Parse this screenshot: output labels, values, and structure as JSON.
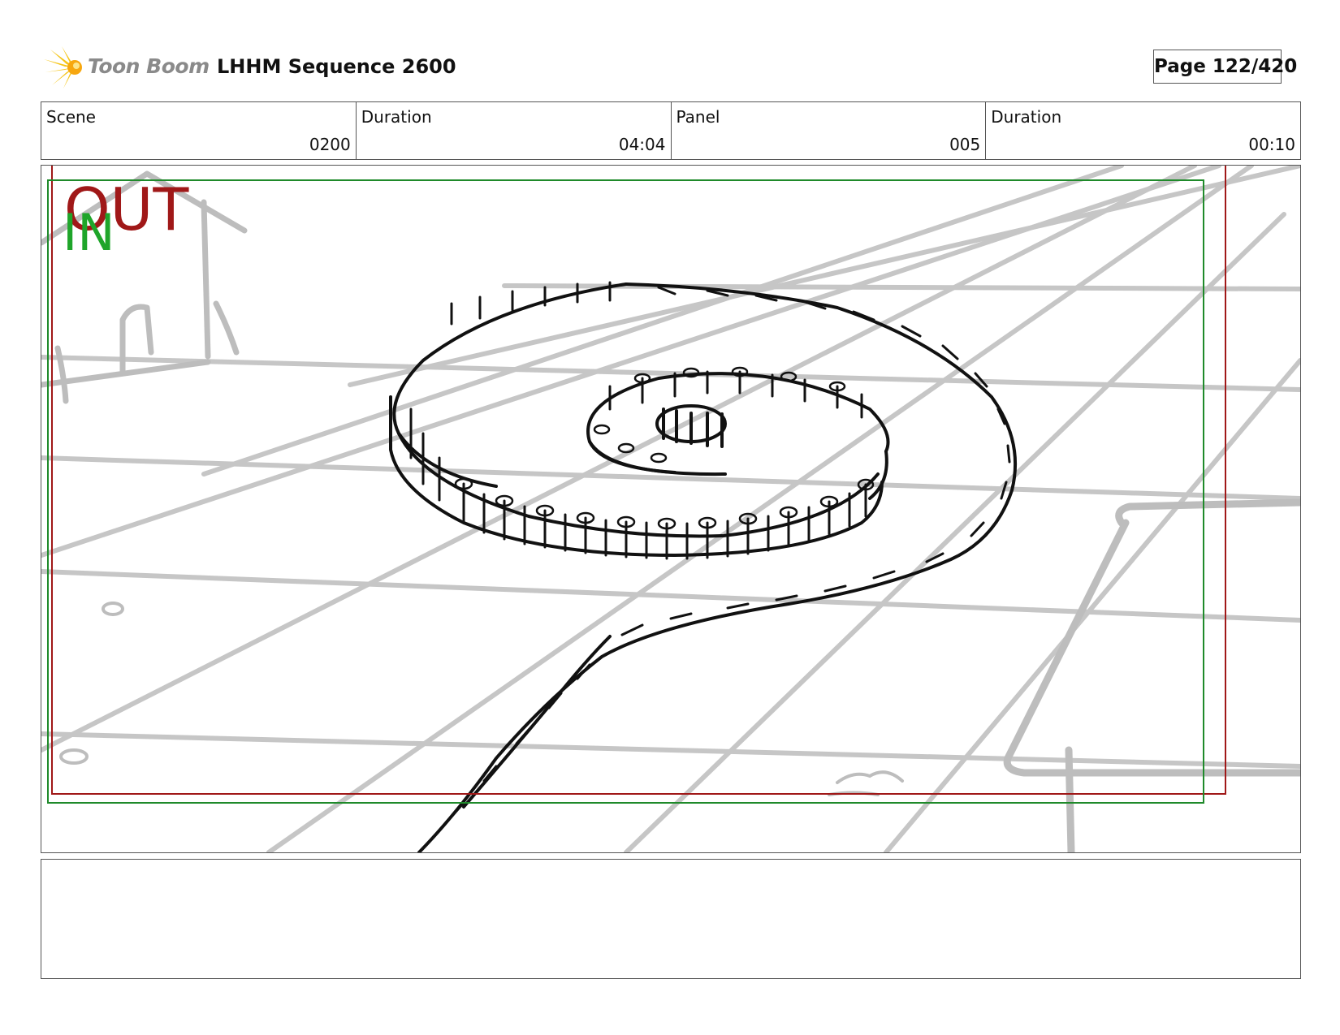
{
  "header": {
    "logo_text": "Toon Boom",
    "sequence_title": "LHHM Sequence 2600",
    "page_label": "Page 122/420"
  },
  "info": {
    "scene_label": "Scene",
    "scene_value": "0200",
    "scene_duration_label": "Duration",
    "scene_duration_value": "04:04",
    "panel_label": "Panel",
    "panel_value": "005",
    "panel_duration_label": "Duration",
    "panel_duration_value": "00:10"
  },
  "panel": {
    "out_label": "OUT",
    "in_label": "IN",
    "out_frame_color": "#a01818",
    "in_frame_color": "#1f8a2a"
  },
  "notes": {
    "text": ""
  }
}
